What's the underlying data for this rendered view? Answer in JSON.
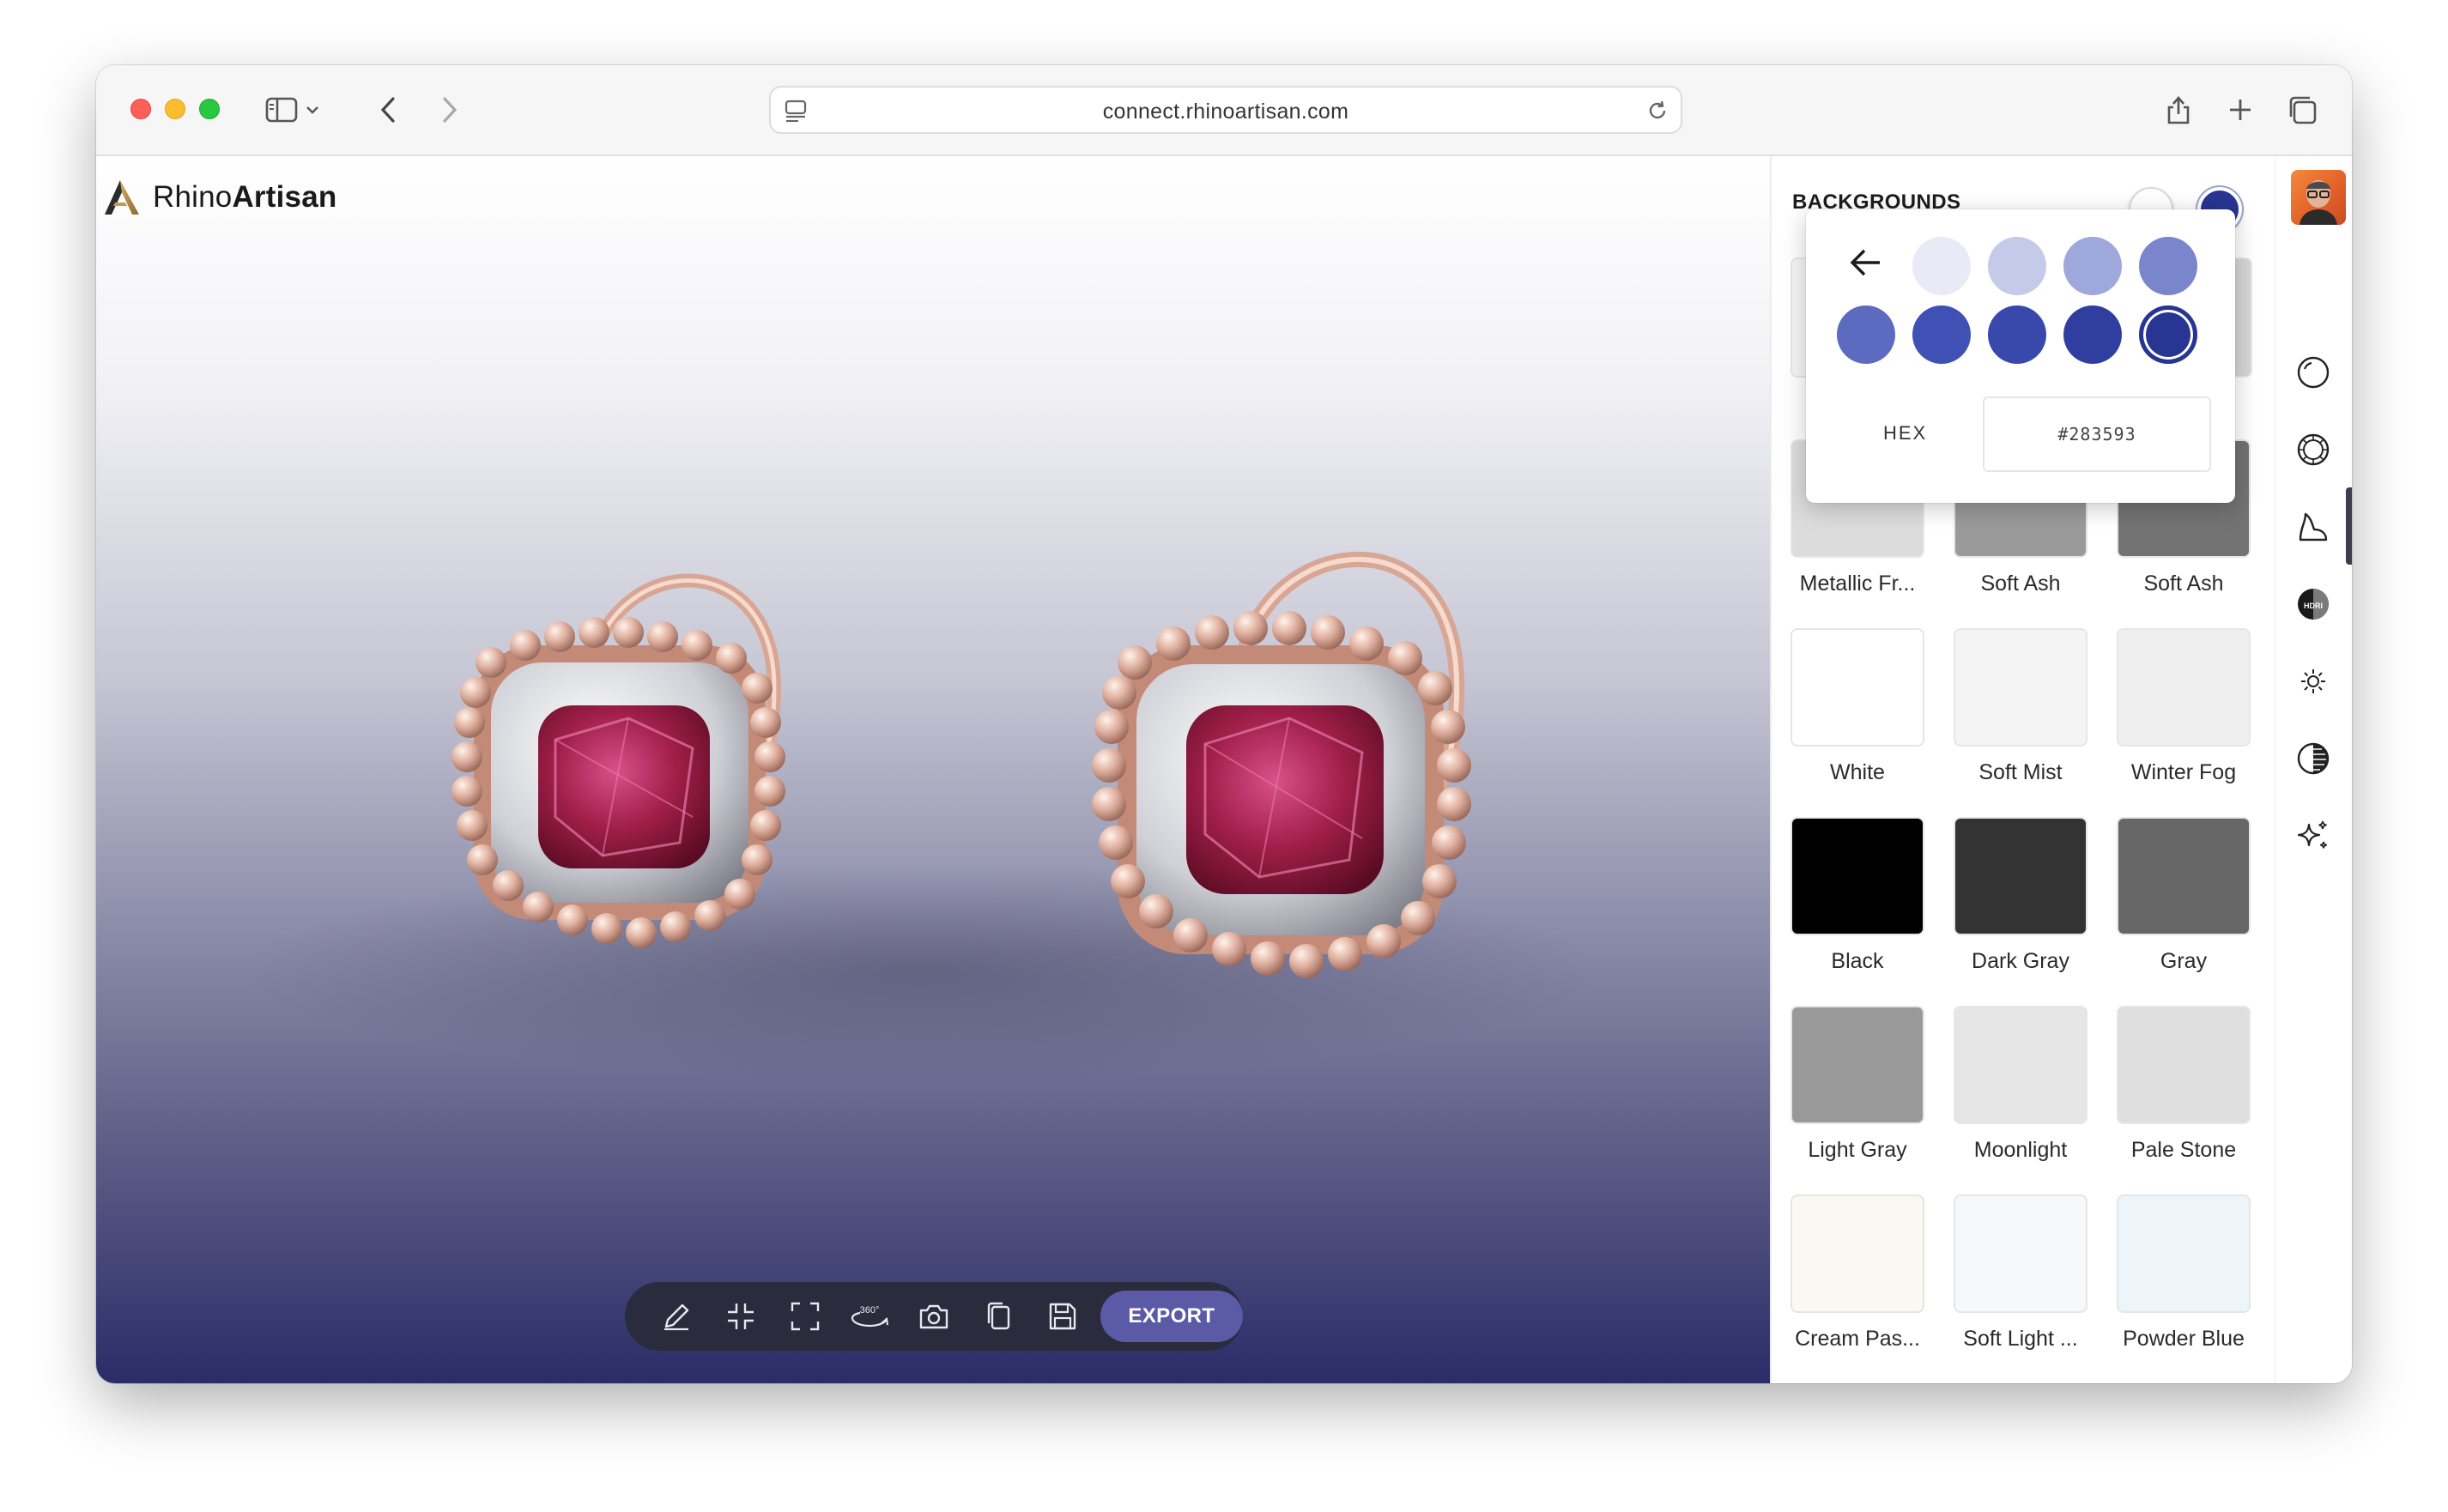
{
  "browser": {
    "url": "connect.rhinoartisan.com"
  },
  "app": {
    "logo_light": "Rhino",
    "logo_bold": "Artisan"
  },
  "toolbar": {
    "tools": [
      "pencil-icon",
      "compress-icon",
      "fullscreen-icon",
      "rotate-360-icon",
      "camera-icon",
      "copy-icon",
      "save-icon"
    ],
    "rotate_label": "360°",
    "export_label": "EXPORT"
  },
  "panel": {
    "title": "BACKGROUNDS",
    "top_swatches": [
      "#ffffff",
      "#283593"
    ],
    "picker": {
      "colors_row1": [
        "#e8eaf6",
        "#c5cae9",
        "#9fa8da",
        "#7986cb"
      ],
      "colors_row2": [
        "#5c6bc0",
        "#3f51b5",
        "#3949ab",
        "#303f9f",
        "#283593"
      ],
      "selected": "#283593",
      "hex_label": "HEX",
      "hex_value": "#283593"
    },
    "backgrounds": [
      {
        "label": "Metallic Fr...",
        "color": "#dcdcdc"
      },
      {
        "label": "Soft Ash",
        "color": "#9a9a9a"
      },
      {
        "label": "Soft Ash",
        "color": "#737373"
      },
      {
        "label": "White",
        "color": "#ffffff"
      },
      {
        "label": "Soft Mist",
        "color": "#f4f4f4"
      },
      {
        "label": "Winter Fog",
        "color": "#efefef"
      },
      {
        "label": "Black",
        "color": "#000000"
      },
      {
        "label": "Dark Gray",
        "color": "#333333"
      },
      {
        "label": "Gray",
        "color": "#666666"
      },
      {
        "label": "Light Gray",
        "color": "#999999"
      },
      {
        "label": "Moonlight",
        "color": "#e6e6e6"
      },
      {
        "label": "Pale Stone",
        "color": "#dedede"
      },
      {
        "label": "Cream Pas...",
        "color": "#fbf7f1"
      },
      {
        "label": "Soft Light ...",
        "color": "#f7f8fa"
      },
      {
        "label": "Powder Blue",
        "color": "#edf4fa"
      }
    ]
  },
  "sidebar": {
    "icons": [
      "material-icon",
      "gem-icon",
      "background-icon",
      "hdri-icon",
      "light-icon",
      "contrast-icon",
      "sparkle-icon"
    ],
    "active": "background-icon",
    "hdri_text": "HDRI"
  }
}
